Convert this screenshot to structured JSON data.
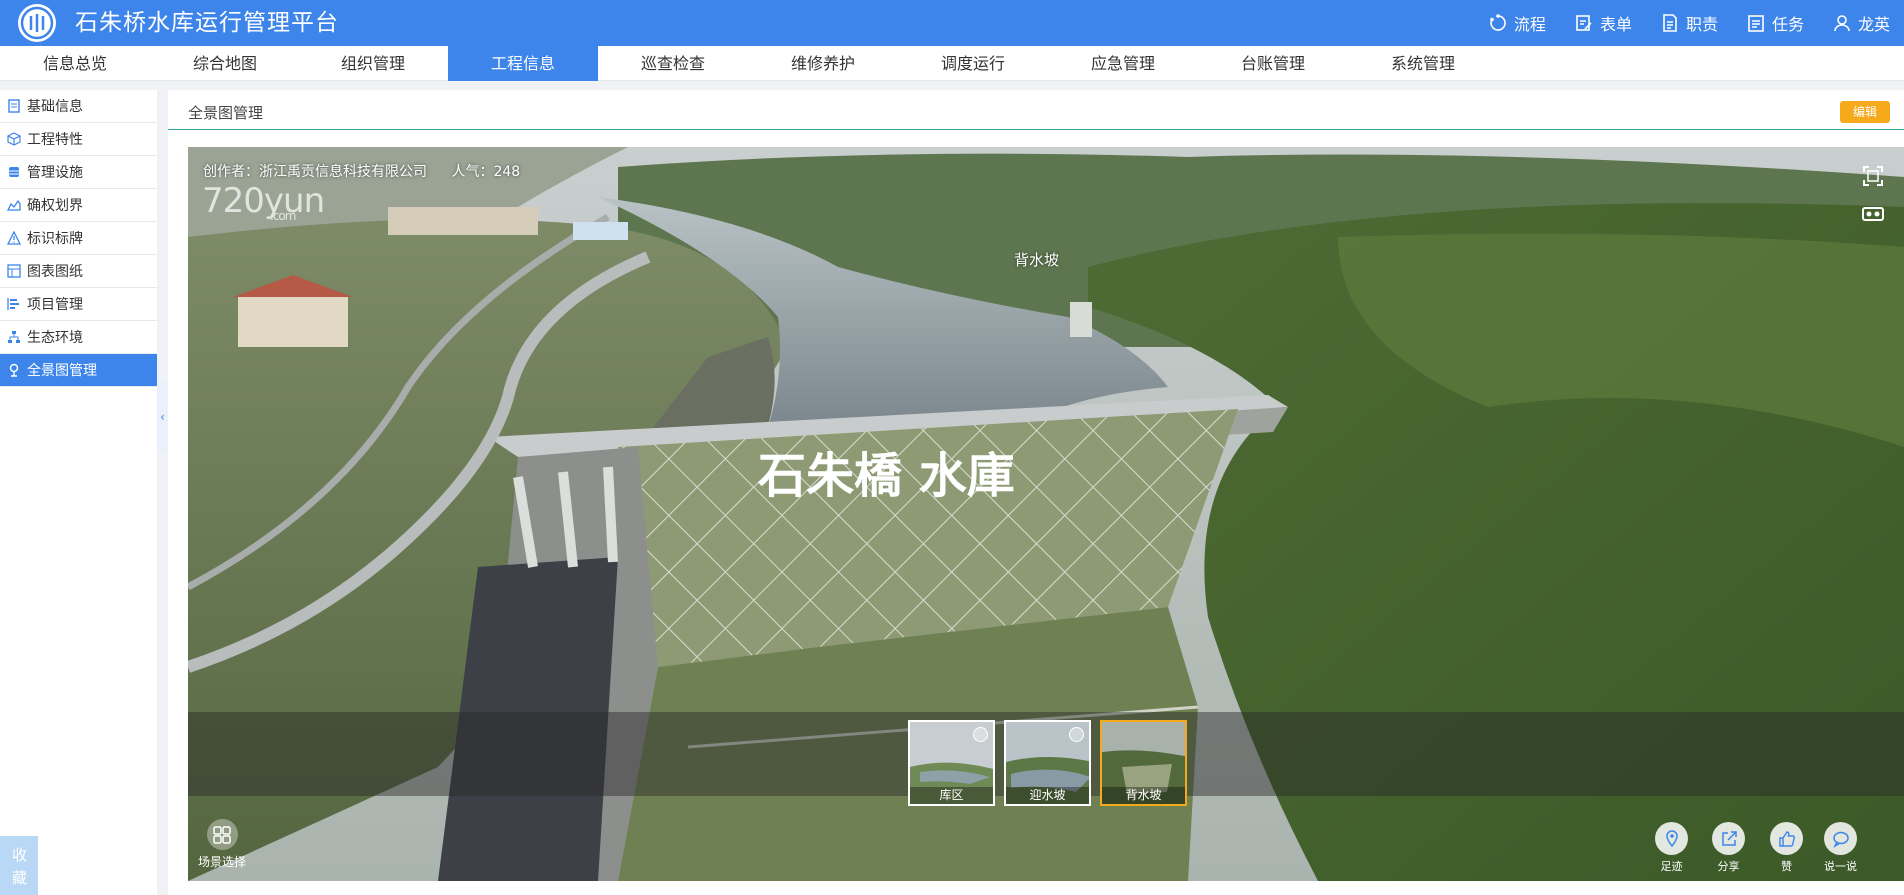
{
  "app": {
    "title": "石朱桥水库运行管理平台"
  },
  "top_actions": [
    {
      "label": "流程",
      "icon": "refresh-flow-icon"
    },
    {
      "label": "表单",
      "icon": "form-edit-icon"
    },
    {
      "label": "职责",
      "icon": "document-icon"
    },
    {
      "label": "任务",
      "icon": "task-list-icon"
    },
    {
      "label": "龙英",
      "icon": "user-icon"
    }
  ],
  "nav_tabs": [
    "信息总览",
    "综合地图",
    "组织管理",
    "工程信息",
    "巡查检查",
    "维修养护",
    "调度运行",
    "应急管理",
    "台账管理",
    "系统管理"
  ],
  "nav_active": "工程信息",
  "sidebar": {
    "items": [
      {
        "label": "基础信息",
        "icon": "file-icon"
      },
      {
        "label": "工程特性",
        "icon": "cube-icon"
      },
      {
        "label": "管理设施",
        "icon": "database-icon"
      },
      {
        "label": "确权划界",
        "icon": "area-chart-icon"
      },
      {
        "label": "标识标牌",
        "icon": "warning-sign-icon"
      },
      {
        "label": "图表图纸",
        "icon": "layout-icon"
      },
      {
        "label": "项目管理",
        "icon": "gantt-icon"
      },
      {
        "label": "生态环境",
        "icon": "hierarchy-icon"
      },
      {
        "label": "全景图管理",
        "icon": "map-pin-icon"
      }
    ],
    "active": "全景图管理",
    "favorites_label": "收藏"
  },
  "content": {
    "title": "全景图管理",
    "edit_label": "编辑"
  },
  "viewer": {
    "creator_label": "创作者：浙江禹贡信息科技有限公司",
    "popularity_label": "人气：248",
    "watermark_main": "720yun",
    "watermark_sub": ".com",
    "hotspot_label": "背水坡",
    "dam_sign": "石朱橋 水庫",
    "scenes": [
      {
        "label": "库区",
        "checked": true,
        "selected": false
      },
      {
        "label": "迎水坡",
        "checked": true,
        "selected": false
      },
      {
        "label": "背水坡",
        "checked": false,
        "selected": true
      }
    ],
    "scene_select_label": "场景选择",
    "tools": [
      {
        "label": "足迹",
        "icon": "footprint-pin-icon"
      },
      {
        "label": "分享",
        "icon": "share-icon"
      },
      {
        "label": "赞",
        "icon": "thumbs-up-icon"
      },
      {
        "label": "说一说",
        "icon": "comment-icon"
      }
    ]
  },
  "colors": {
    "primary": "#3d85ea",
    "accent": "#f5a91b",
    "divider": "#2fa39b"
  }
}
